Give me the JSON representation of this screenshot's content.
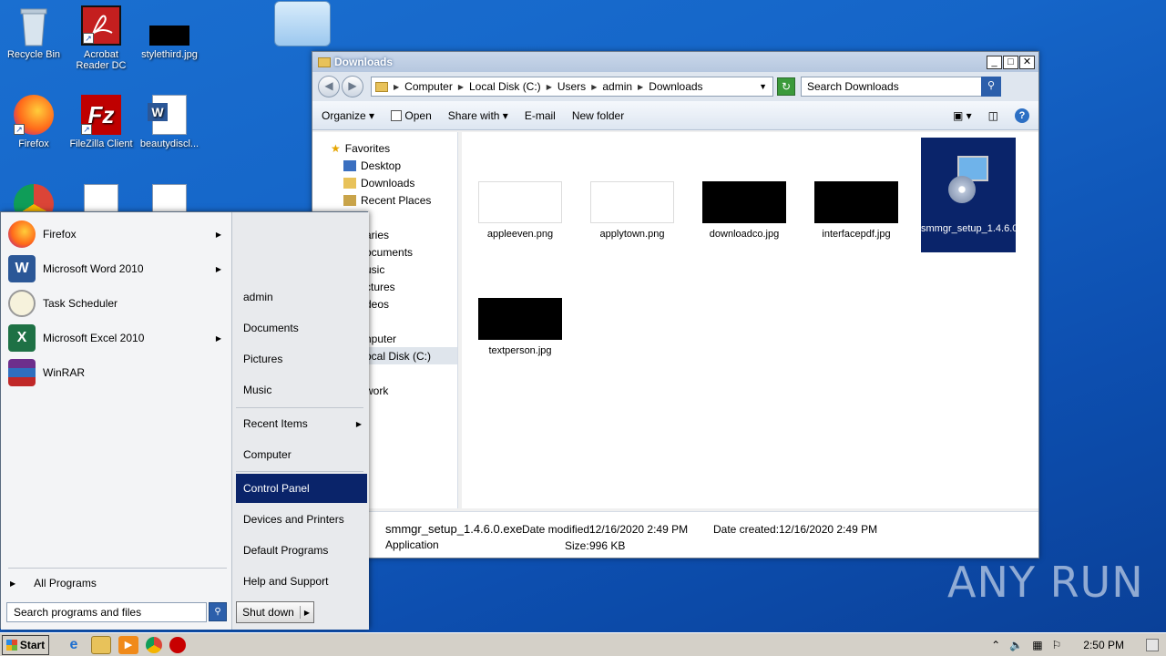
{
  "desktop": {
    "icons": [
      {
        "label": "Recycle Bin"
      },
      {
        "label": "Acrobat Reader DC"
      },
      {
        "label": "stylethird.jpg"
      },
      {
        "label": "Firefox"
      },
      {
        "label": "FileZilla Client"
      },
      {
        "label": "beautydiscl..."
      }
    ]
  },
  "explorer": {
    "title": "Downloads",
    "buttons": {
      "minimize": "_",
      "maximize": "□",
      "close": "✕"
    },
    "breadcrumb": [
      "Computer",
      "Local Disk (C:)",
      "Users",
      "admin",
      "Downloads"
    ],
    "search_placeholder": "Search Downloads",
    "toolbar": {
      "organize": "Organize",
      "open": "Open",
      "share_with": "Share with",
      "email": "E-mail",
      "new_folder": "New folder"
    },
    "nav": {
      "favorites": "Favorites",
      "desktop": "Desktop",
      "downloads": "Downloads",
      "recent": "Recent Places",
      "libraries": "aries",
      "documents": "ocuments",
      "music": "usic",
      "pictures": "ctures",
      "videos": "deos",
      "computer": "nputer",
      "localdisk": "ocal Disk (C:)",
      "network": "work"
    },
    "files": [
      {
        "name": "appleeven.png"
      },
      {
        "name": "applytown.png"
      },
      {
        "name": "downloadco.jpg"
      },
      {
        "name": "interfacepdf.jpg"
      },
      {
        "name": "smmgr_setup_1.4.6.0.exe"
      },
      {
        "name": "textperson.jpg"
      }
    ],
    "details": {
      "filename": "smmgr_setup_1.4.6.0.exe",
      "type": "Application",
      "date_modified_label": "Date modified:",
      "date_modified": "12/16/2020 2:49 PM",
      "date_created_label": "Date created:",
      "date_created": "12/16/2020 2:49 PM",
      "size_label": "Size:",
      "size": "996 KB"
    }
  },
  "startmenu": {
    "programs": [
      {
        "label": "Firefox"
      },
      {
        "label": "Microsoft Word 2010"
      },
      {
        "label": "Task Scheduler"
      },
      {
        "label": "Microsoft Excel 2010"
      },
      {
        "label": "WinRAR"
      }
    ],
    "all_programs": "All Programs",
    "search_placeholder": "Search programs and files",
    "right": {
      "admin": "admin",
      "documents": "Documents",
      "pictures": "Pictures",
      "music": "Music",
      "recent_items": "Recent Items",
      "computer": "Computer",
      "control_panel": "Control Panel",
      "devices": "Devices and Printers",
      "default_programs": "Default Programs",
      "help": "Help and Support"
    },
    "shutdown": "Shut down"
  },
  "taskbar": {
    "start": "Start",
    "clock": "2:50 PM"
  },
  "watermark": "ANY RUN"
}
